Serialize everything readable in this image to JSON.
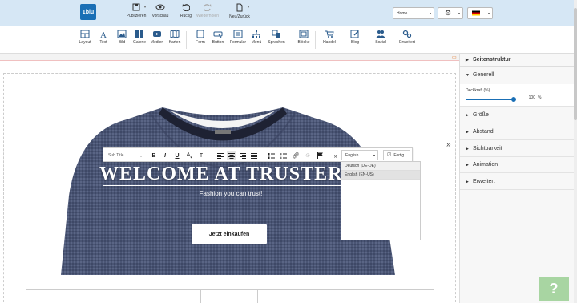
{
  "app": {
    "logo_text": "1blu"
  },
  "topbar": {
    "publish": "Publizieren",
    "preview": "Vorschau",
    "undo": "Rückg",
    "redo": "Wiederholen",
    "new_back": "Neu/Zurück",
    "page_select": "Home",
    "accent": "#1a6fb5"
  },
  "tools": [
    {
      "label": "Layout",
      "icon": "layout-icon"
    },
    {
      "label": "Text",
      "icon": "text-icon"
    },
    {
      "label": "Bild",
      "icon": "image-icon"
    },
    {
      "label": "Galerie",
      "icon": "gallery-icon"
    },
    {
      "label": "Medien",
      "icon": "media-icon"
    },
    {
      "label": "Karten",
      "icon": "map-icon"
    },
    {
      "label": "Form",
      "icon": "form-icon"
    },
    {
      "label": "Button",
      "icon": "button-icon"
    },
    {
      "label": "Formular",
      "icon": "formular-icon"
    },
    {
      "label": "Menü",
      "icon": "menu-icon"
    },
    {
      "label": "Sprachen",
      "icon": "languages-icon"
    },
    {
      "label": "Blöcke",
      "icon": "blocks-icon"
    },
    {
      "label": "Handel",
      "icon": "cart-icon"
    },
    {
      "label": "Blog",
      "icon": "blog-icon"
    },
    {
      "label": "Sozial",
      "icon": "social-icon"
    },
    {
      "label": "Erweitert",
      "icon": "advanced-icon"
    }
  ],
  "right_panel": {
    "title": "Seitenstruktur",
    "general": "Generell",
    "opacity_label": "Deckkraft (%)",
    "opacity_value": "100",
    "opacity_unit": "%",
    "opacity_level": 1.0,
    "sections": [
      "Größe",
      "Abstand",
      "Sichtbarkeit",
      "Animation",
      "Erweitert"
    ]
  },
  "editor": {
    "style_select": "Sub Title",
    "lang_select": "English",
    "done_label": "Fertig",
    "lang_options": [
      "Deutsch (DE-DE)",
      "English (EN-US)"
    ]
  },
  "hero": {
    "heading": "WELCOME AT TRUSTER",
    "subtitle": "Fashion you can trust!",
    "cta": "Jetzt einkaufen"
  },
  "help": {
    "label": "?"
  }
}
